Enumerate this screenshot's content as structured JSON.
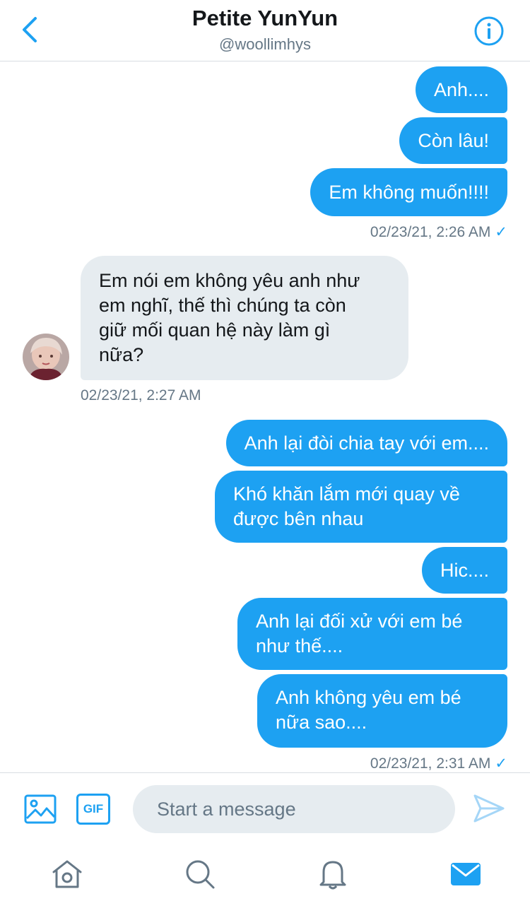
{
  "header": {
    "title": "Petite YunYun",
    "handle": "@woollimhys",
    "back_icon": "chevron-left-icon",
    "info_icon": "info-icon"
  },
  "messages": {
    "m1": "Anh....",
    "m2": "Còn lâu!",
    "m3": "Em không muốn!!!!",
    "ts1": "02/23/21, 2:26 AM",
    "in1_line1": "Em nói em không yêu anh như",
    "in1_line2": "em nghĩ, thế thì chúng ta còn",
    "in1_line3": "giữ mối quan hệ này làm gì",
    "in1_line4": "nữa?",
    "ts2": "02/23/21, 2:27 AM",
    "m4": "Anh lại đòi chia tay với em....",
    "m5_line1": "Khó khăn lắm mới quay về",
    "m5_line2": "được bên nhau",
    "m6": "Hic....",
    "m7_line1": "Anh lại đối xử với em bé",
    "m7_line2": "như thế....",
    "m8_line1": "Anh không yêu em bé",
    "m8_line2": "nữa sao....",
    "ts3": "02/23/21, 2:31 AM",
    "check": "✓"
  },
  "composer": {
    "placeholder": "Start a message",
    "gif_label": "GIF"
  },
  "tabs": [
    "home-icon",
    "search-icon",
    "bell-icon",
    "mail-icon"
  ],
  "colors": {
    "accent": "#1da1f2",
    "incoming_bg": "#e6ecf0",
    "muted": "#657786"
  }
}
